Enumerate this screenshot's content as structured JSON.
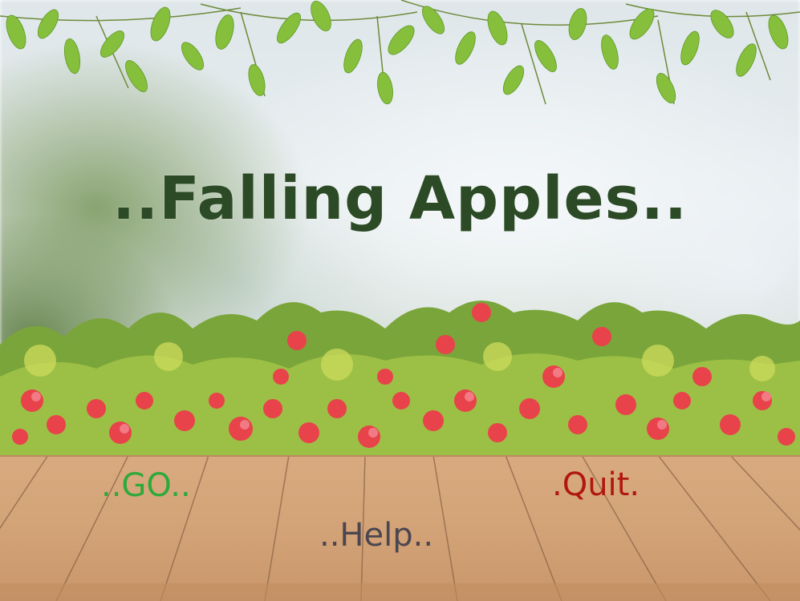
{
  "title": "..Falling Apples..",
  "menu": {
    "go_label": "..GO..",
    "help_label": "..Help..",
    "quit_label": ".Quit."
  },
  "colors": {
    "title": "#2b4a25",
    "go": "#2ea93a",
    "quit": "#b0170f",
    "help": "#4b4650",
    "deck": "#d4a479",
    "flowers": "#e8424a",
    "leaves": "#7cb83a"
  }
}
